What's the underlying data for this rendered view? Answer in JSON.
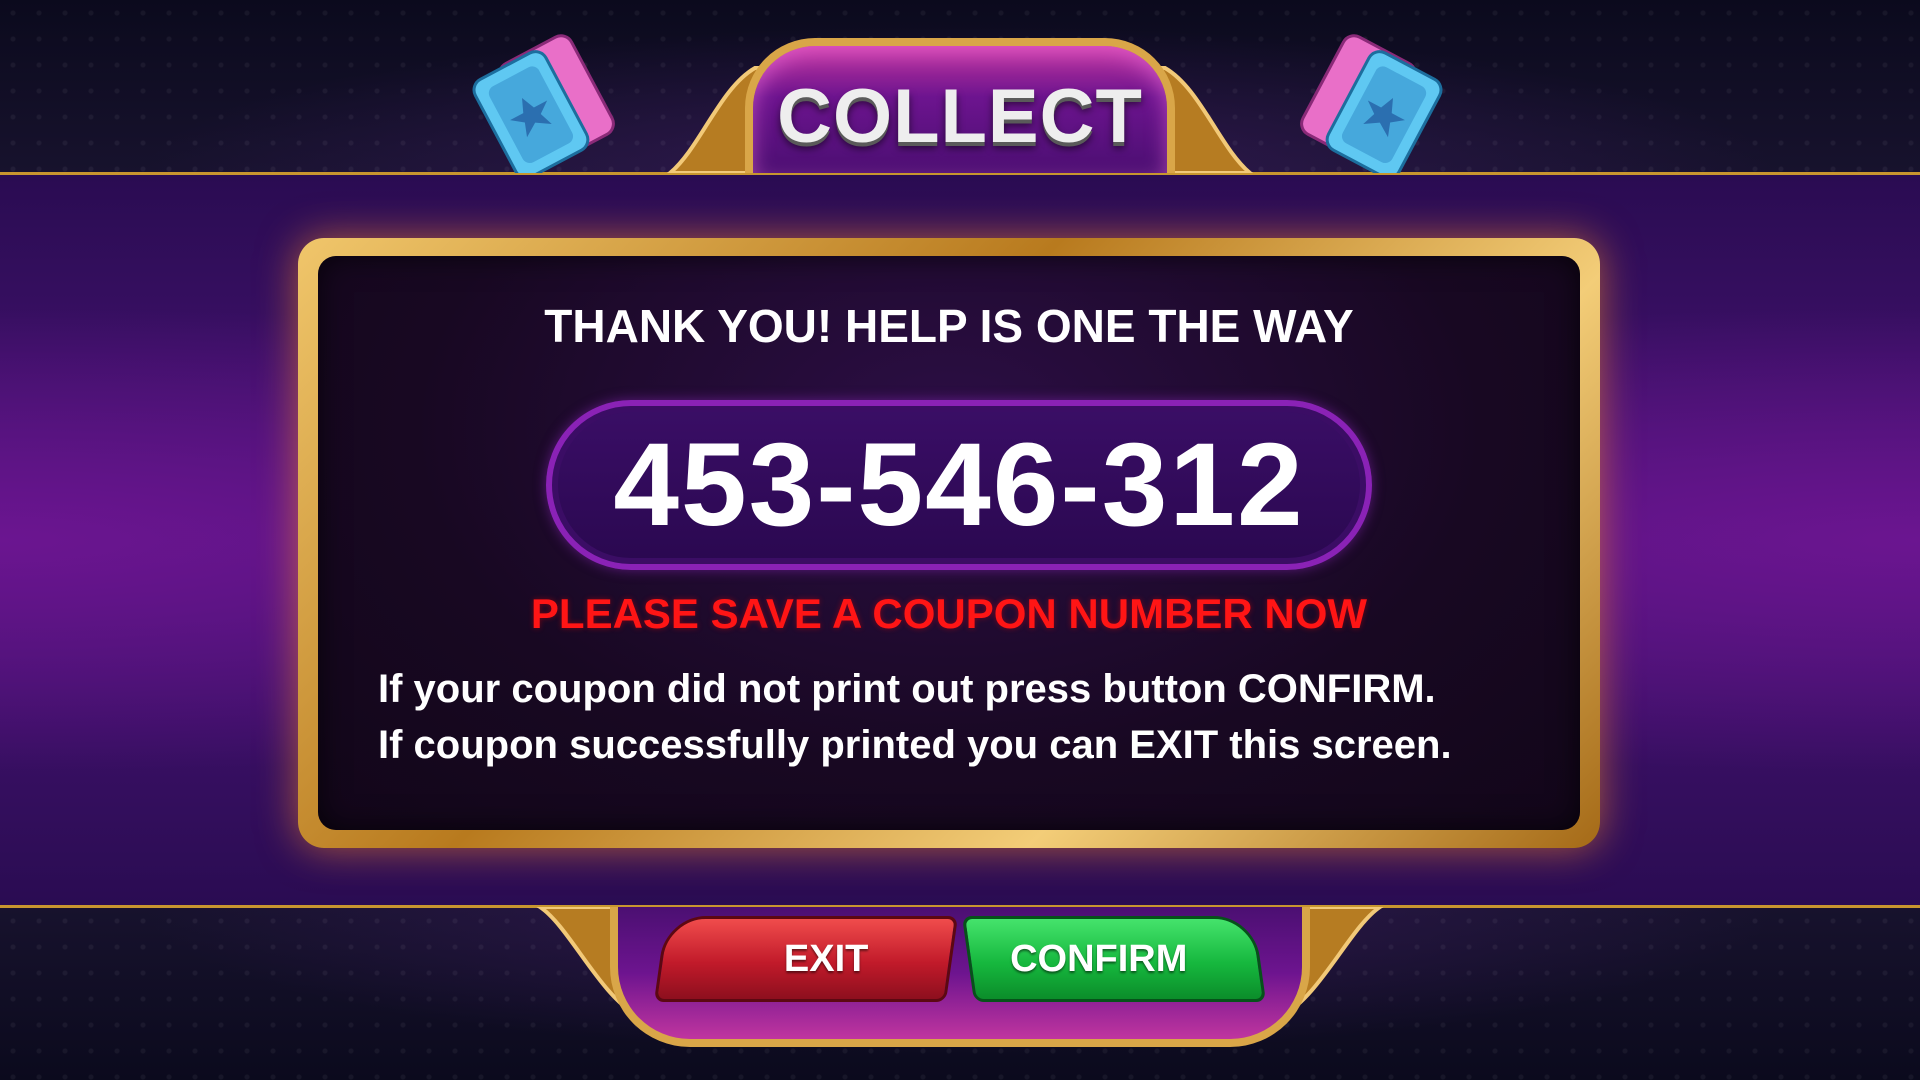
{
  "title": "COLLECT",
  "panel": {
    "heading": "THANK YOU! HELP IS ONE THE WAY",
    "coupon_number": "453-546-312",
    "warning": "PLEASE SAVE A COUPON NUMBER NOW",
    "instructions": [
      "If your coupon did not print out press button CONFIRM.",
      "If coupon successfully printed you can EXIT this screen."
    ]
  },
  "buttons": {
    "exit_label": "EXIT",
    "confirm_label": "CONFIRM"
  },
  "icons": {
    "left_decor": "ticket-icon",
    "right_decor": "ticket-icon"
  },
  "colors": {
    "background": "#4a1378",
    "gold_frame": "#d9a648",
    "warning": "#ff1515",
    "exit_button": "#c11a2a",
    "confirm_button": "#16b83e"
  }
}
